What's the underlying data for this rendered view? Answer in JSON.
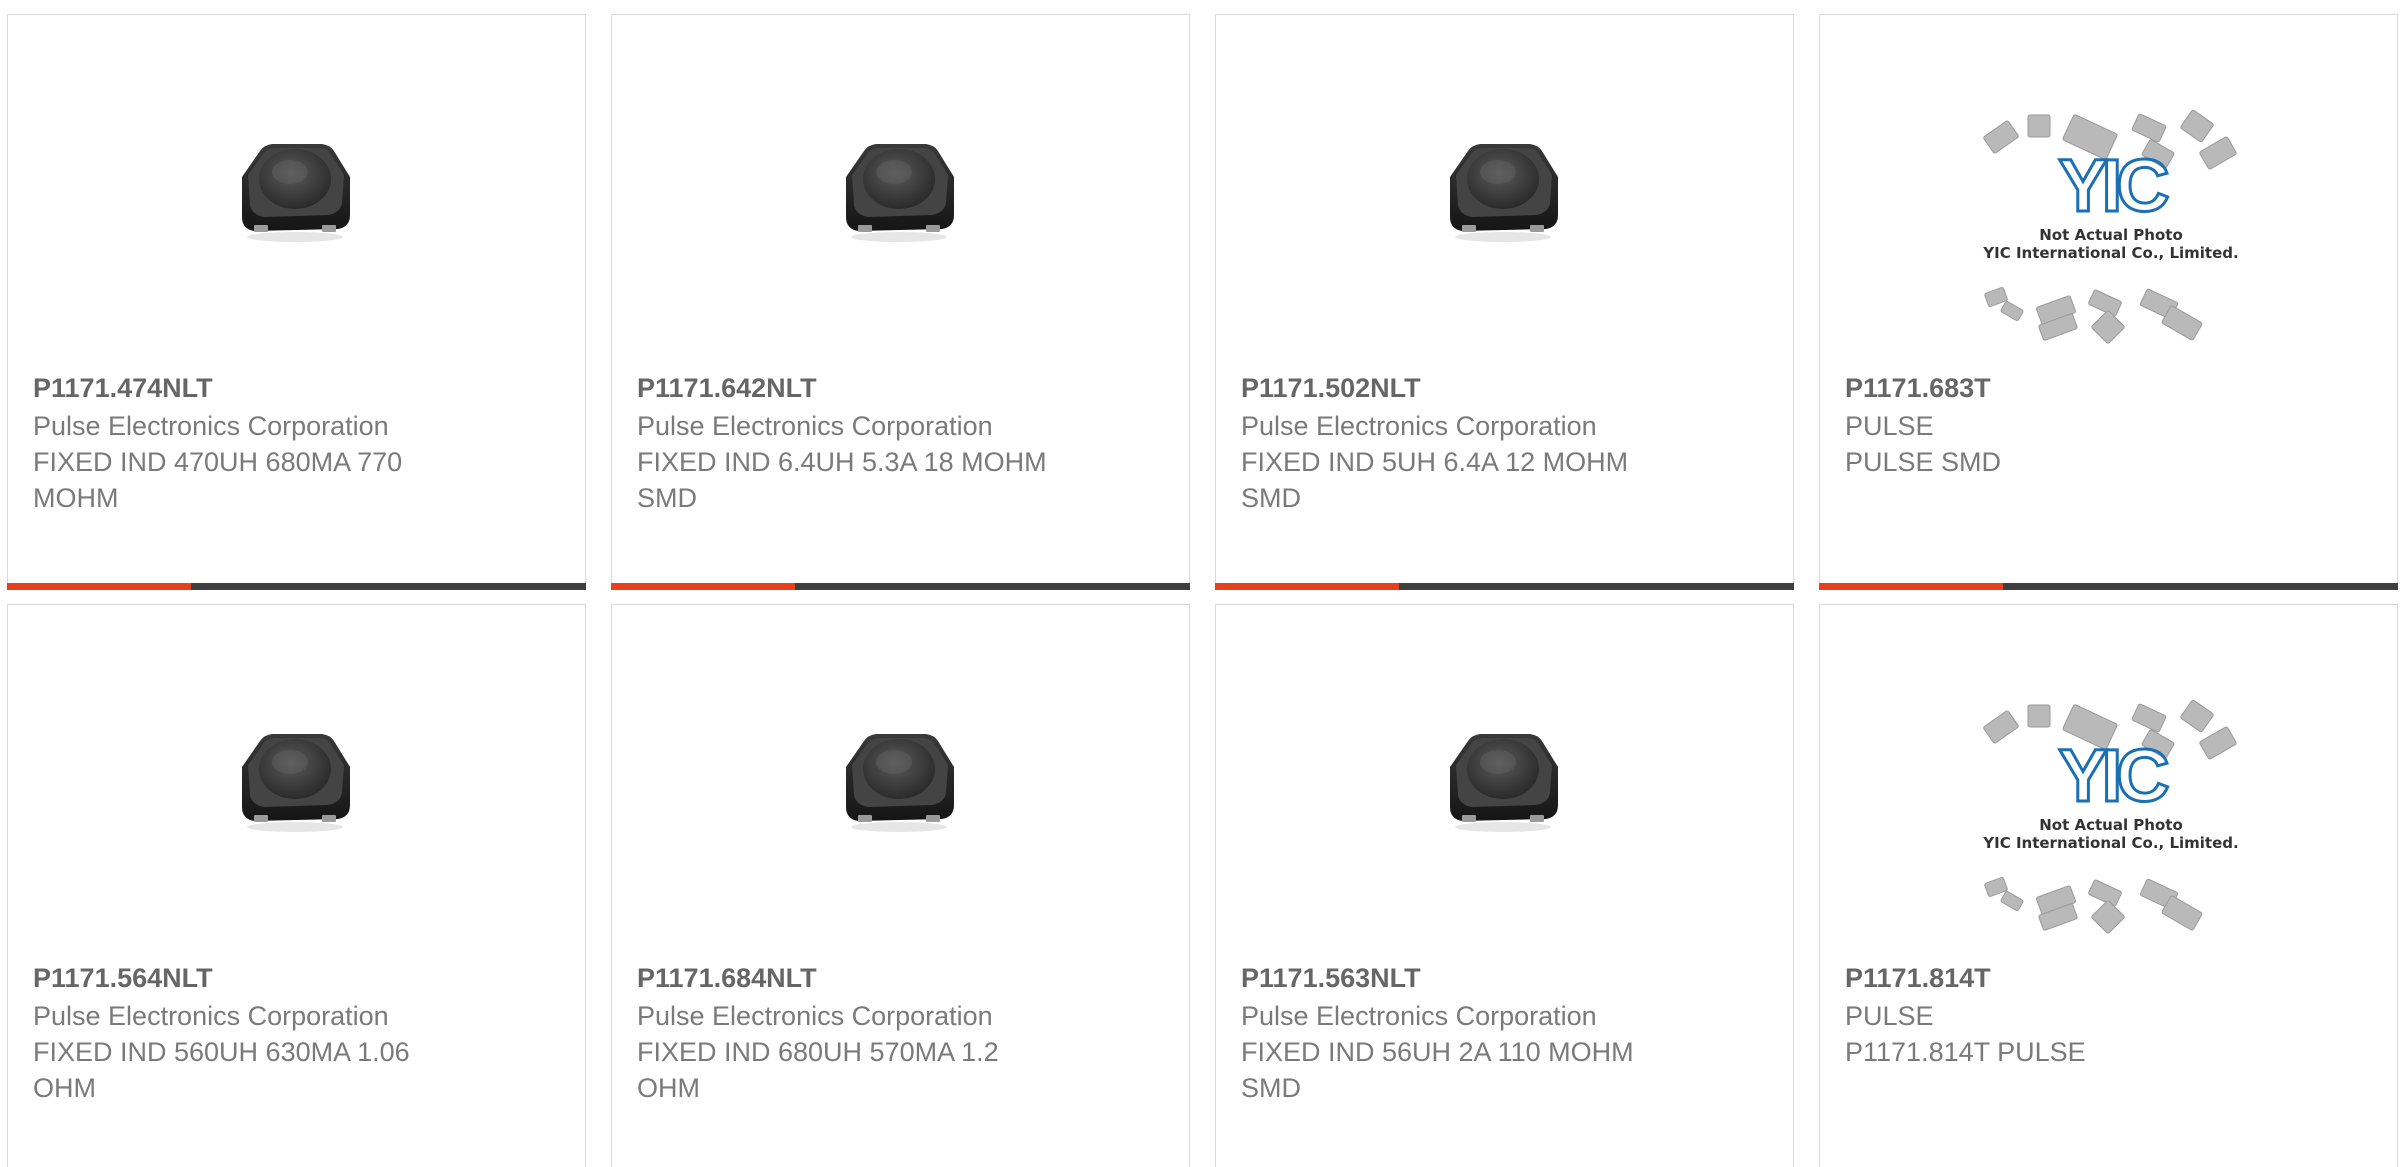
{
  "products": [
    {
      "part_number": "P1171.474NLT",
      "manufacturer": "Pulse Electronics Corporation",
      "description": "FIXED IND 470UH 680MA 770 MOHM",
      "image": "inductor-photo"
    },
    {
      "part_number": "P1171.642NLT",
      "manufacturer": "Pulse Electronics Corporation",
      "description": "FIXED IND 6.4UH 5.3A 18 MOHM SMD",
      "image": "inductor-photo"
    },
    {
      "part_number": "P1171.502NLT",
      "manufacturer": "Pulse Electronics Corporation",
      "description": "FIXED IND 5UH 6.4A 12 MOHM SMD",
      "image": "inductor-photo"
    },
    {
      "part_number": "P1171.683T",
      "manufacturer": "PULSE",
      "description": "PULSE SMD",
      "image": "placeholder-photo"
    },
    {
      "part_number": "P1171.564NLT",
      "manufacturer": "Pulse Electronics Corporation",
      "description": "FIXED IND 560UH 630MA 1.06 OHM",
      "image": "inductor-photo"
    },
    {
      "part_number": "P1171.684NLT",
      "manufacturer": "Pulse Electronics Corporation",
      "description": "FIXED IND 680UH 570MA 1.2 OHM",
      "image": "inductor-photo"
    },
    {
      "part_number": "P1171.563NLT",
      "manufacturer": "Pulse Electronics Corporation",
      "description": "FIXED IND 56UH 2A 110 MOHM SMD",
      "image": "inductor-photo"
    },
    {
      "part_number": "P1171.814T",
      "manufacturer": "PULSE",
      "description": "P1171.814T PULSE",
      "image": "placeholder-photo"
    }
  ],
  "placeholder": {
    "logo_text": "YIC",
    "line1": "Not Actual Photo",
    "line2": "YIC International Co., Limited."
  },
  "colors": {
    "accent": "#e8401c",
    "bar": "#3f3f3f",
    "text": "#7a7a7a",
    "logo": "#1a6fb5"
  }
}
